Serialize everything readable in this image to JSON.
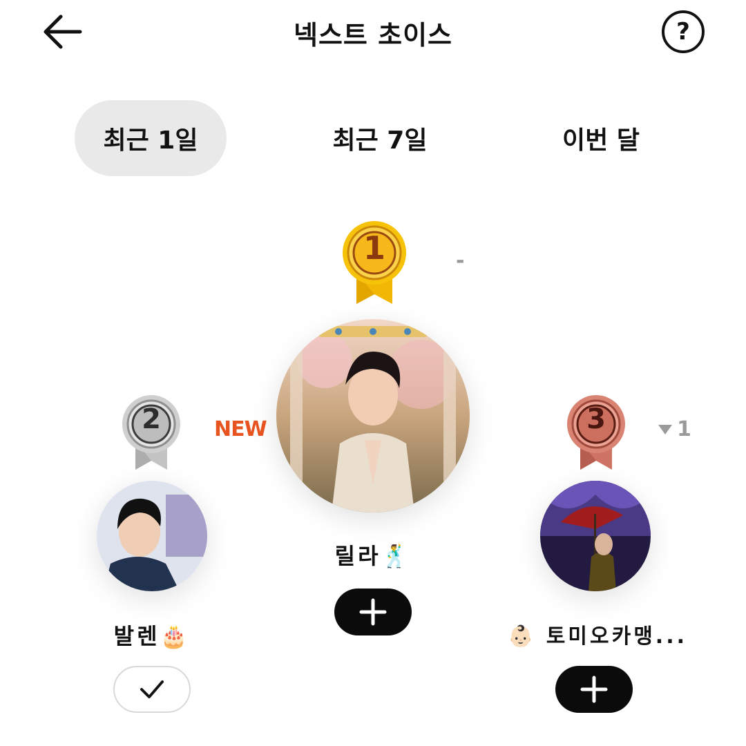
{
  "header": {
    "title": "넥스트 초이스",
    "back_icon": "arrow-left-icon",
    "help_label": "?"
  },
  "tabs": [
    {
      "label": "최근 1일",
      "active": true
    },
    {
      "label": "최근 7일",
      "active": false
    },
    {
      "label": "이번 달",
      "active": false
    }
  ],
  "ranking": [
    {
      "rank": "1",
      "name": "릴라🕺",
      "change": "-",
      "badge": "",
      "action": "add",
      "medal_color": "gold"
    },
    {
      "rank": "2",
      "name": "발렌🎂",
      "change": "",
      "badge": "NEW",
      "action": "added",
      "medal_color": "silver"
    },
    {
      "rank": "3",
      "name": "👶🏻 토미오카맹...",
      "change": "1",
      "change_dir": "down",
      "badge": "",
      "action": "add",
      "medal_color": "bronze"
    }
  ],
  "colors": {
    "gold": "#f4b400",
    "silver": "#b9b9b9",
    "bronze": "#c86a5a",
    "new_badge": "#e8541f",
    "active_tab_bg": "#e9e9e9"
  }
}
